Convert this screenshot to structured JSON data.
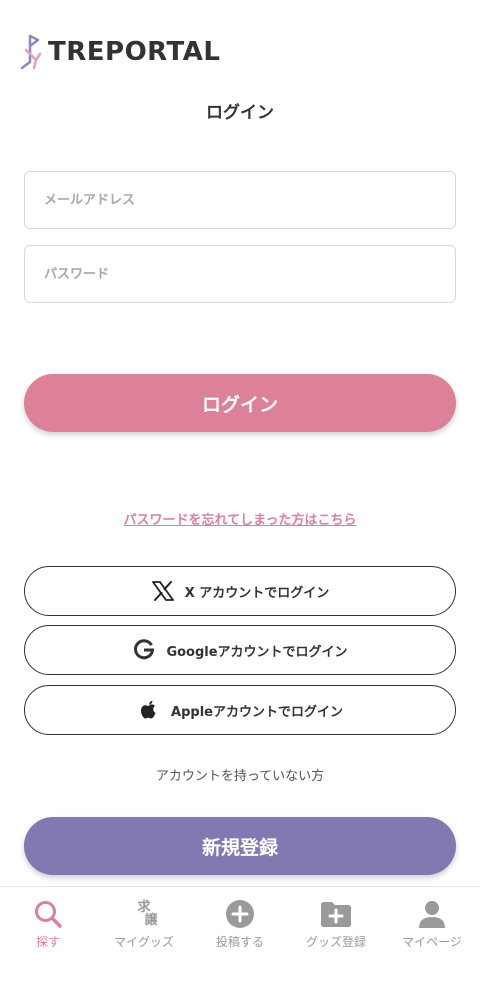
{
  "app": {
    "logo_text": "TREPORTAL"
  },
  "page": {
    "title": "ログイン"
  },
  "form": {
    "email_placeholder": "メールアドレス",
    "email_value": "",
    "password_placeholder": "パスワード",
    "password_value": "",
    "login_button": "ログイン",
    "forgot_link": "パスワードを忘れてしまった方はこちら"
  },
  "social": {
    "x_label": "X アカウントでログイン",
    "google_label": "Googleアカウントでログイン",
    "apple_label": "Appleアカウントでログイン"
  },
  "register": {
    "prompt": "アカウントを持っていない方",
    "button": "新規登録"
  },
  "bottom_nav": {
    "items": [
      {
        "label": "探す",
        "icon": "search-icon",
        "active": true
      },
      {
        "label": "マイグッズ",
        "icon": "my-goods-icon",
        "icon_text_top": "求",
        "icon_text_bottom": "譲",
        "active": false
      },
      {
        "label": "投稿する",
        "icon": "plus-circle-icon",
        "active": false
      },
      {
        "label": "グッズ登録",
        "icon": "folder-plus-icon",
        "active": false
      },
      {
        "label": "マイページ",
        "icon": "person-icon",
        "active": false
      }
    ]
  },
  "colors": {
    "accent_pink": "#dc8198",
    "accent_purple": "#8278b2",
    "text": "#333333",
    "muted": "#9a9a9a"
  }
}
